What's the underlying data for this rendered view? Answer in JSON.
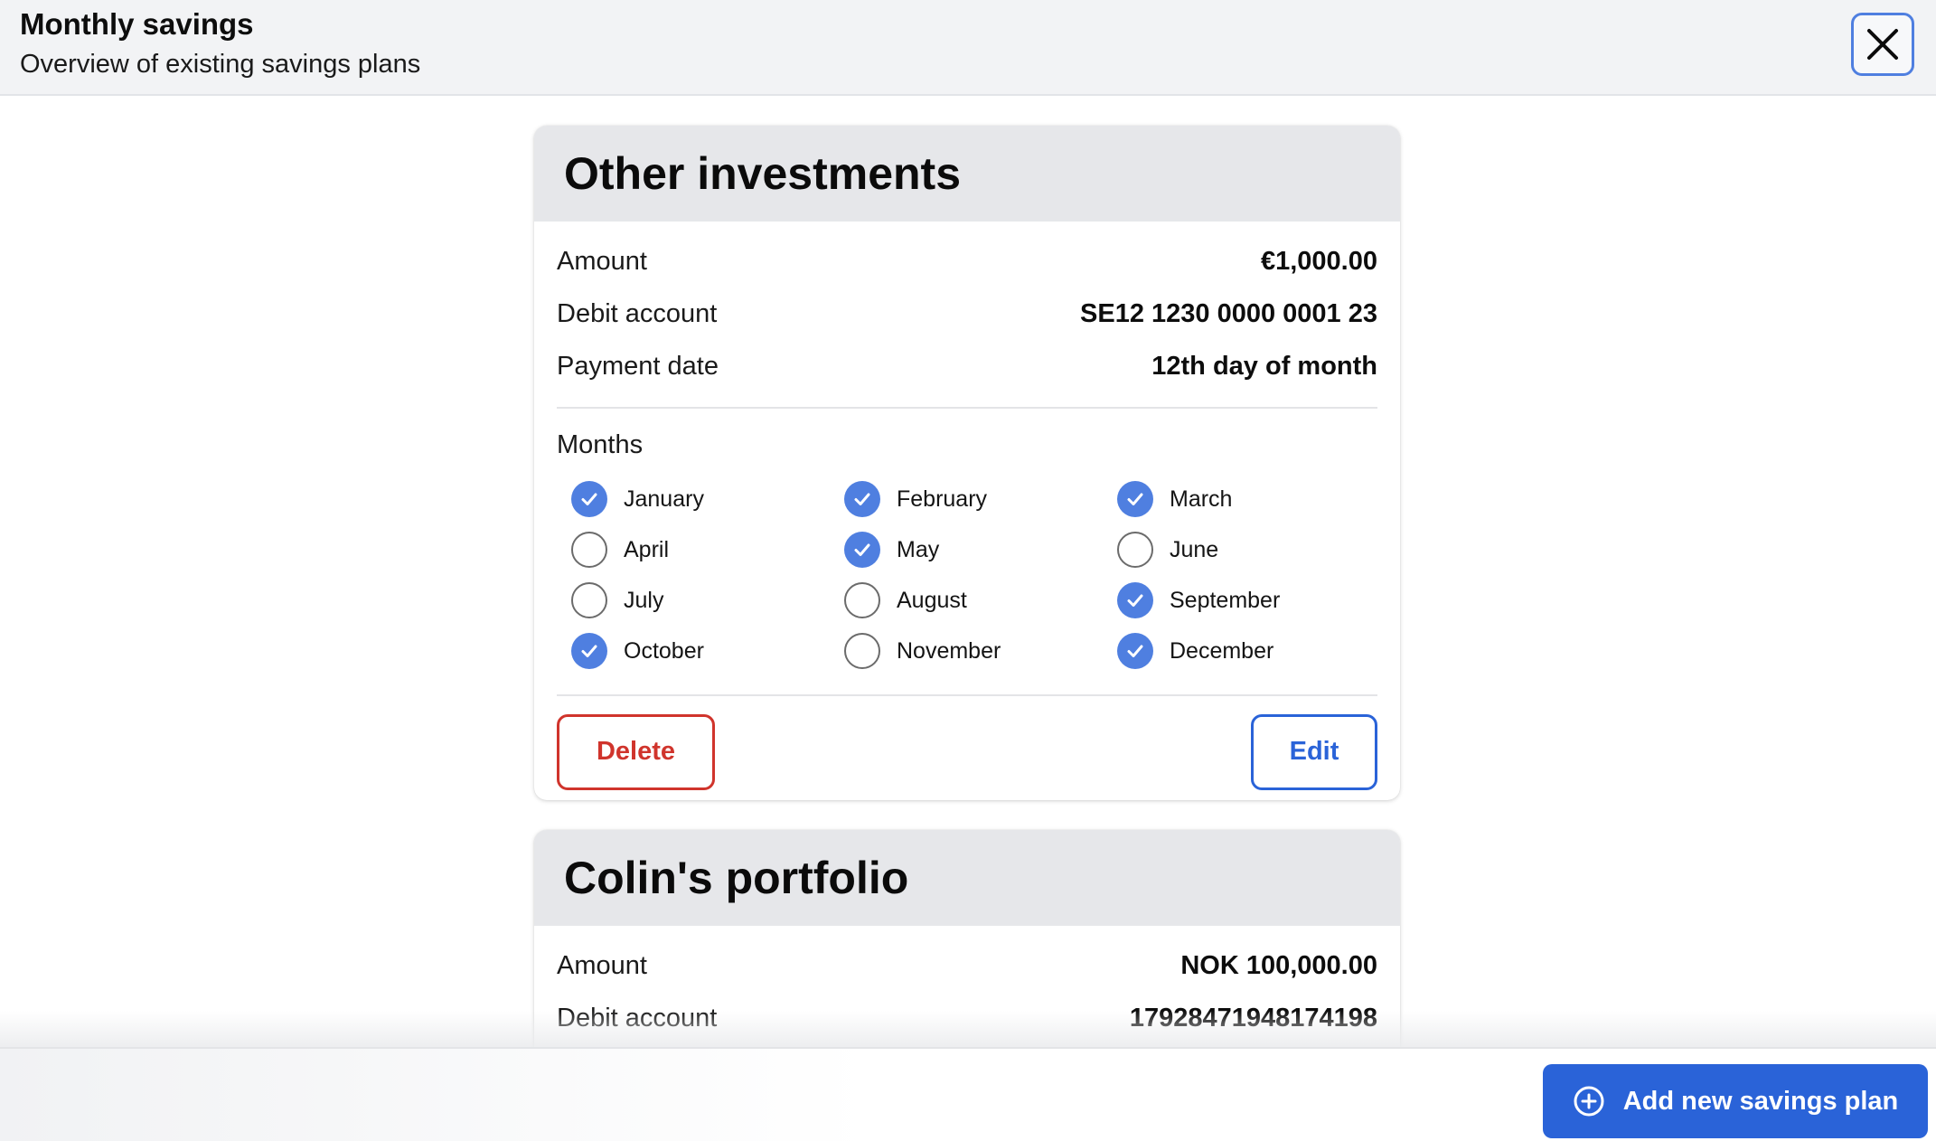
{
  "header": {
    "title": "Monthly savings",
    "subtitle": "Overview of existing savings plans",
    "close_icon": "close-icon"
  },
  "plans": [
    {
      "title": "Other investments",
      "details": [
        {
          "label": "Amount",
          "value": "€1,000.00"
        },
        {
          "label": "Debit account",
          "value": "SE12 1230 0000 0001 23"
        },
        {
          "label": "Payment date",
          "value": "12th day of month"
        }
      ],
      "months_label": "Months",
      "months": [
        {
          "name": "January",
          "checked": true
        },
        {
          "name": "February",
          "checked": true
        },
        {
          "name": "March",
          "checked": true
        },
        {
          "name": "April",
          "checked": false
        },
        {
          "name": "May",
          "checked": true
        },
        {
          "name": "June",
          "checked": false
        },
        {
          "name": "July",
          "checked": false
        },
        {
          "name": "August",
          "checked": false
        },
        {
          "name": "September",
          "checked": true
        },
        {
          "name": "October",
          "checked": true
        },
        {
          "name": "November",
          "checked": false
        },
        {
          "name": "December",
          "checked": true
        }
      ],
      "delete_label": "Delete",
      "edit_label": "Edit"
    },
    {
      "title": "Colin's portfolio",
      "details": [
        {
          "label": "Amount",
          "value": "NOK 100,000.00"
        },
        {
          "label": "Debit account",
          "value": "17928471948174198"
        }
      ]
    }
  ],
  "footer": {
    "add_label": "Add new savings plan",
    "add_icon": "plus-circle-icon"
  },
  "colors": {
    "accent": "#4f7fe0",
    "primary_button": "#2a63d8",
    "danger": "#d0342c",
    "header_bg": "#f2f3f5",
    "card_header_bg": "#e6e7ea"
  }
}
